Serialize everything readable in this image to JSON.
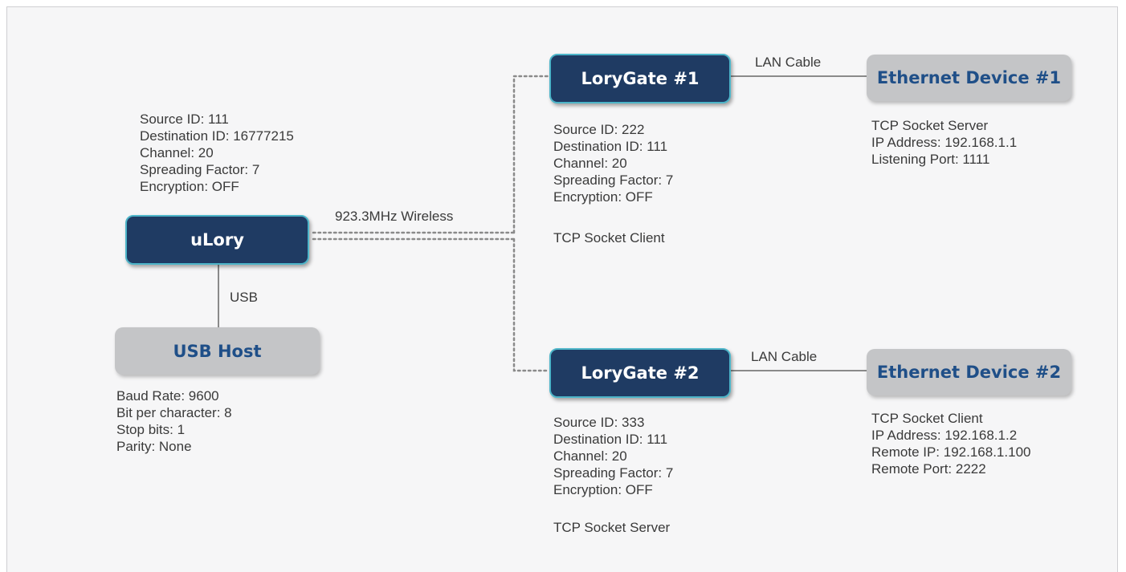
{
  "nodes": {
    "ulory": "uLory",
    "usb_host": "USB Host",
    "lorygate1": "LoryGate #1",
    "lorygate2": "LoryGate #2",
    "eth1": "Ethernet Device #1",
    "eth2": "Ethernet Device #2"
  },
  "links": {
    "wireless": "923.3MHz Wireless",
    "usb": "USB",
    "lan1": "LAN Cable",
    "lan2": "LAN Cable"
  },
  "ulory_info": [
    "Source ID: 111",
    "Destination ID: 16777215",
    "Channel: 20",
    "Spreading Factor: 7",
    "Encryption: OFF"
  ],
  "usb_host_info": [
    "Baud Rate: 9600",
    "Bit per character: 8",
    "Stop bits: 1",
    "Parity: None"
  ],
  "lorygate1_info": [
    "Source ID: 222",
    "Destination ID: 111",
    "Channel: 20",
    "Spreading Factor: 7",
    "Encryption: OFF"
  ],
  "lorygate1_role": "TCP Socket Client",
  "lorygate2_info": [
    "Source ID: 333",
    "Destination ID: 111",
    "Channel: 20",
    "Spreading Factor: 7",
    "Encryption: OFF"
  ],
  "lorygate2_role": "TCP Socket Server",
  "eth1_info": [
    "TCP Socket Server",
    "IP Address: 192.168.1.1",
    "Listening Port: 1111"
  ],
  "eth2_info": [
    "TCP Socket Client",
    "IP Address: 192.168.1.2",
    "Remote IP: 192.168.1.100",
    "Remote Port: 2222"
  ],
  "colors": {
    "node_dark": "#1f3b63",
    "node_border": "#4db5c9",
    "node_grey": "#c4c5c7",
    "grey_text": "#1f4f88"
  }
}
